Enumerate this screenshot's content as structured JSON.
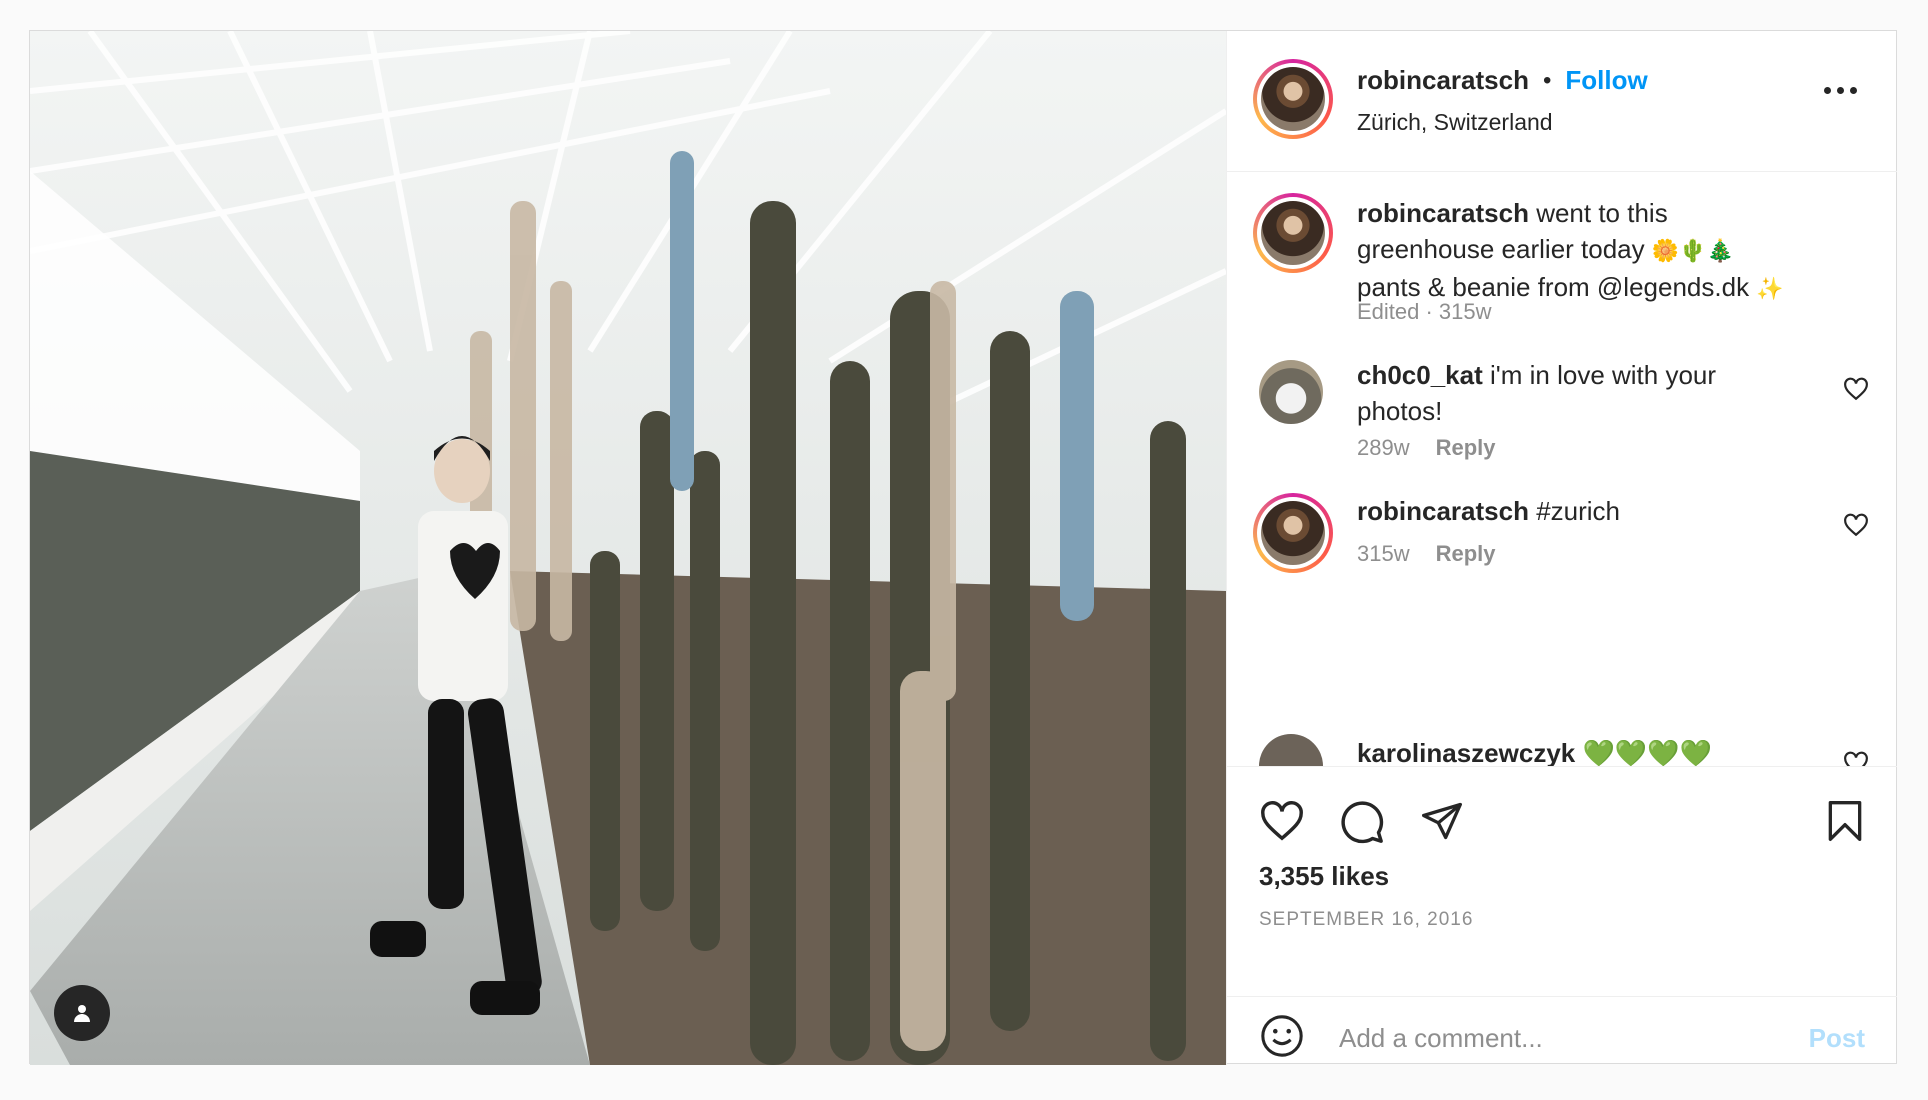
{
  "post": {
    "username": "robincaratsch",
    "separator": "•",
    "follow_label": "Follow",
    "location": "Zürich, Switzerland"
  },
  "caption": {
    "username": "robincaratsch",
    "text_line1": "went to this",
    "text_line2": "greenhouse earlier today",
    "text_line2_emoji": "🌼🌵🎄",
    "text_line3": "pants & beanie from @legends.dk",
    "text_line3_emoji": "✨",
    "meta": "Edited · 315w"
  },
  "comments": [
    {
      "username": "ch0c0_kat",
      "text_line1": "i'm in love with your",
      "text_line2": "photos!",
      "age": "289w",
      "reply_label": "Reply"
    },
    {
      "username": "robincaratsch",
      "text": "#zurich",
      "age": "315w",
      "reply_label": "Reply"
    },
    {
      "username": "karolinaszewczyk",
      "text": "💚💚💚💚"
    }
  ],
  "engagement": {
    "likes": "3,355 likes",
    "date": "SEPTEMBER 16, 2016"
  },
  "add_comment": {
    "placeholder": "Add a comment...",
    "post_label": "Post"
  },
  "icons": {
    "like": "heart-icon",
    "comment": "comment-icon",
    "share": "send-icon",
    "save": "bookmark-icon",
    "more": "more-horizontal-icon",
    "emoji": "smiley-icon",
    "tag": "user-tag-icon"
  },
  "colors": {
    "follow": "#0095f6",
    "post_disabled": "#b2dffc",
    "muted": "#8e8e8e"
  }
}
